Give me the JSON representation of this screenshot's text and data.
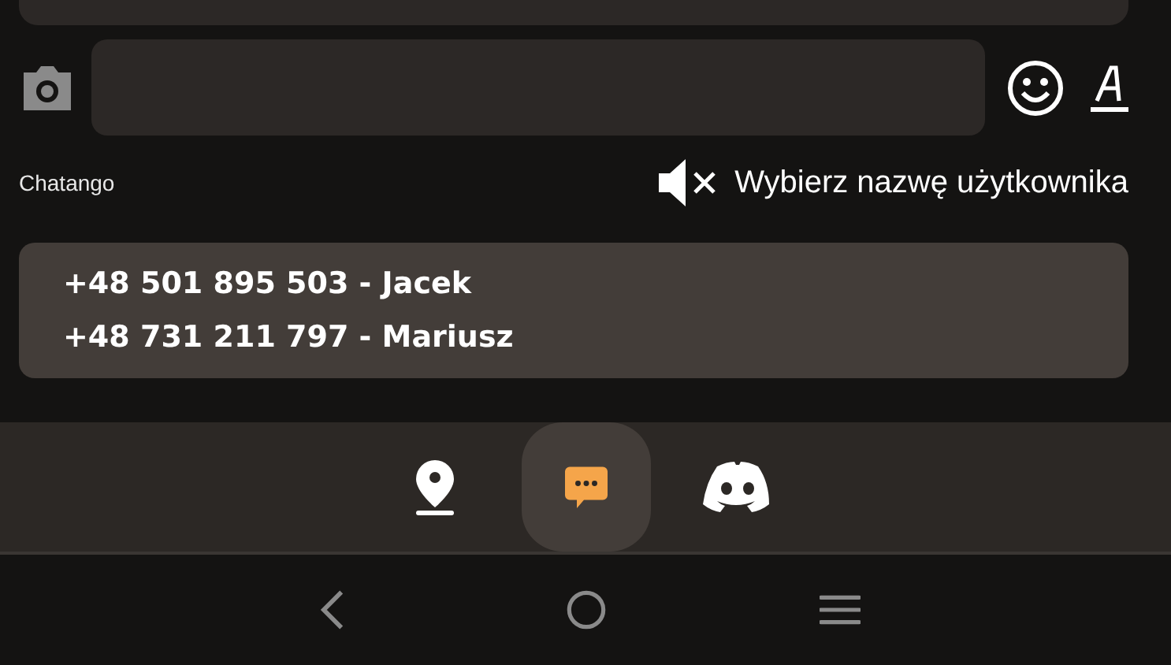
{
  "footer": {
    "brand": "Chatango",
    "sound_muted": true,
    "username_prompt": "Wybierz nazwę użytkownika"
  },
  "contacts": [
    "+48 501 895 503 - Jacek",
    "+48 731 211 797 - Mariusz"
  ],
  "tabs": [
    {
      "kind": "map",
      "selected": false
    },
    {
      "kind": "chat",
      "selected": true
    },
    {
      "kind": "discord",
      "selected": false
    }
  ]
}
